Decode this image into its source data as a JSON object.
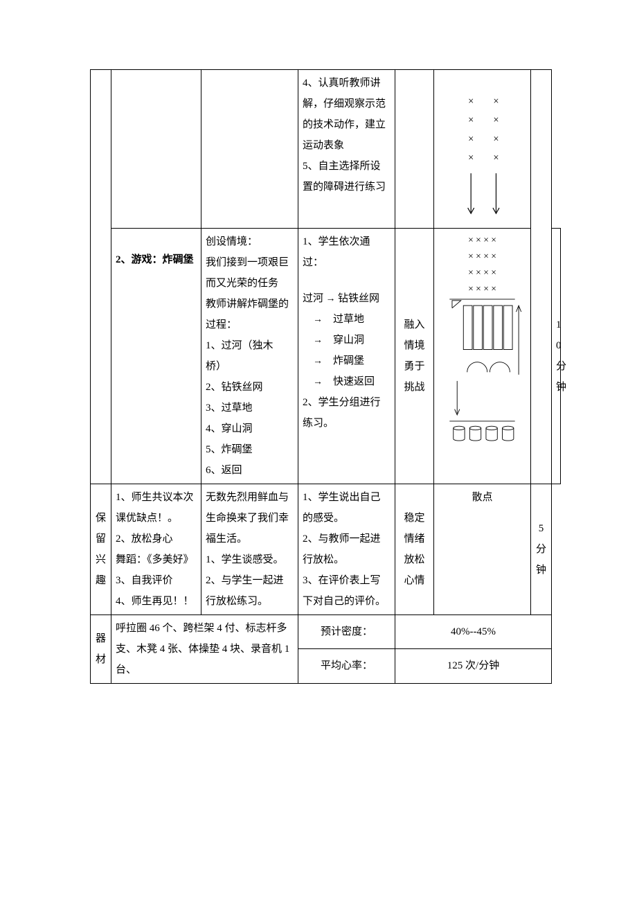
{
  "row1": {
    "student_activity": "4、认真听教师讲解，仔细观察示范的技术动作，建立运动表象\n5、自主选择所设置的障碍进行练习"
  },
  "row2": {
    "content": "2、游戏：炸碉堡",
    "teacher": "创设情境：\n我们接到一项艰巨而又光荣的任务\n教师讲解炸碉堡的过程：\n1、过河（独木桥）\n2、钻铁丝网\n3、过草地\n4、穿山洞\n5、炸碉堡\n6、返回",
    "student_intro": "1、学生依次通过：",
    "flow_start": "过河",
    "flow_items": [
      "钻铁丝网",
      "过草地",
      "穿山洞",
      "炸碉堡",
      "快速返回"
    ],
    "student_end": "2、学生分组进行练习。",
    "intent": "融入情境\n勇于挑战",
    "time": "10\n分\n钟"
  },
  "row3": {
    "section": "保\n留\n兴\n趣",
    "content": "1、师生共议本次课优缺点！。\n2、放松身心\n舞蹈：《多美好》\n3、自我评价\n4、师生再见！！",
    "teacher": "无数先烈用鲜血与生命换来了我们幸福生活。\n1、学生谈感受。\n2、与学生一起进行放松练习。",
    "student": "1、学生说出自己的感受。\n2、与教师一起进行放松。\n3、在评价表上写下对自己的评价。",
    "intent": "稳定情绪\n放松心情",
    "diagram_label": "散点",
    "time": "5\n分\n钟"
  },
  "row4": {
    "section": "器\n材",
    "content": "呼拉圈 46 个、跨栏架 4 付、标志杆多支、木凳 4 张、体操垫 4 块、录音机 1 台、",
    "density_label": "预计密度：",
    "density_value": "40%--45%",
    "hr_label": "平均心率：",
    "hr_value": "125 次/分钟"
  },
  "chart_data": [
    {
      "type": "diagram",
      "title": "row1 diagram",
      "description": "2 columns × 4 rows of × marks, two downward arrows below",
      "grid": {
        "rows": 4,
        "cols": 2,
        "symbol": "×"
      },
      "arrows": 2
    },
    {
      "type": "diagram",
      "title": "row2 diagram",
      "description": "4 rows of ×××× above a course with 5 vertical lanes, 2 arches, 4 cylinders at bottom, flow arrows",
      "marks": {
        "rows": 4,
        "cols": 4,
        "symbol": "×"
      },
      "lanes": 5,
      "arches": 2,
      "cylinders": 4
    }
  ]
}
